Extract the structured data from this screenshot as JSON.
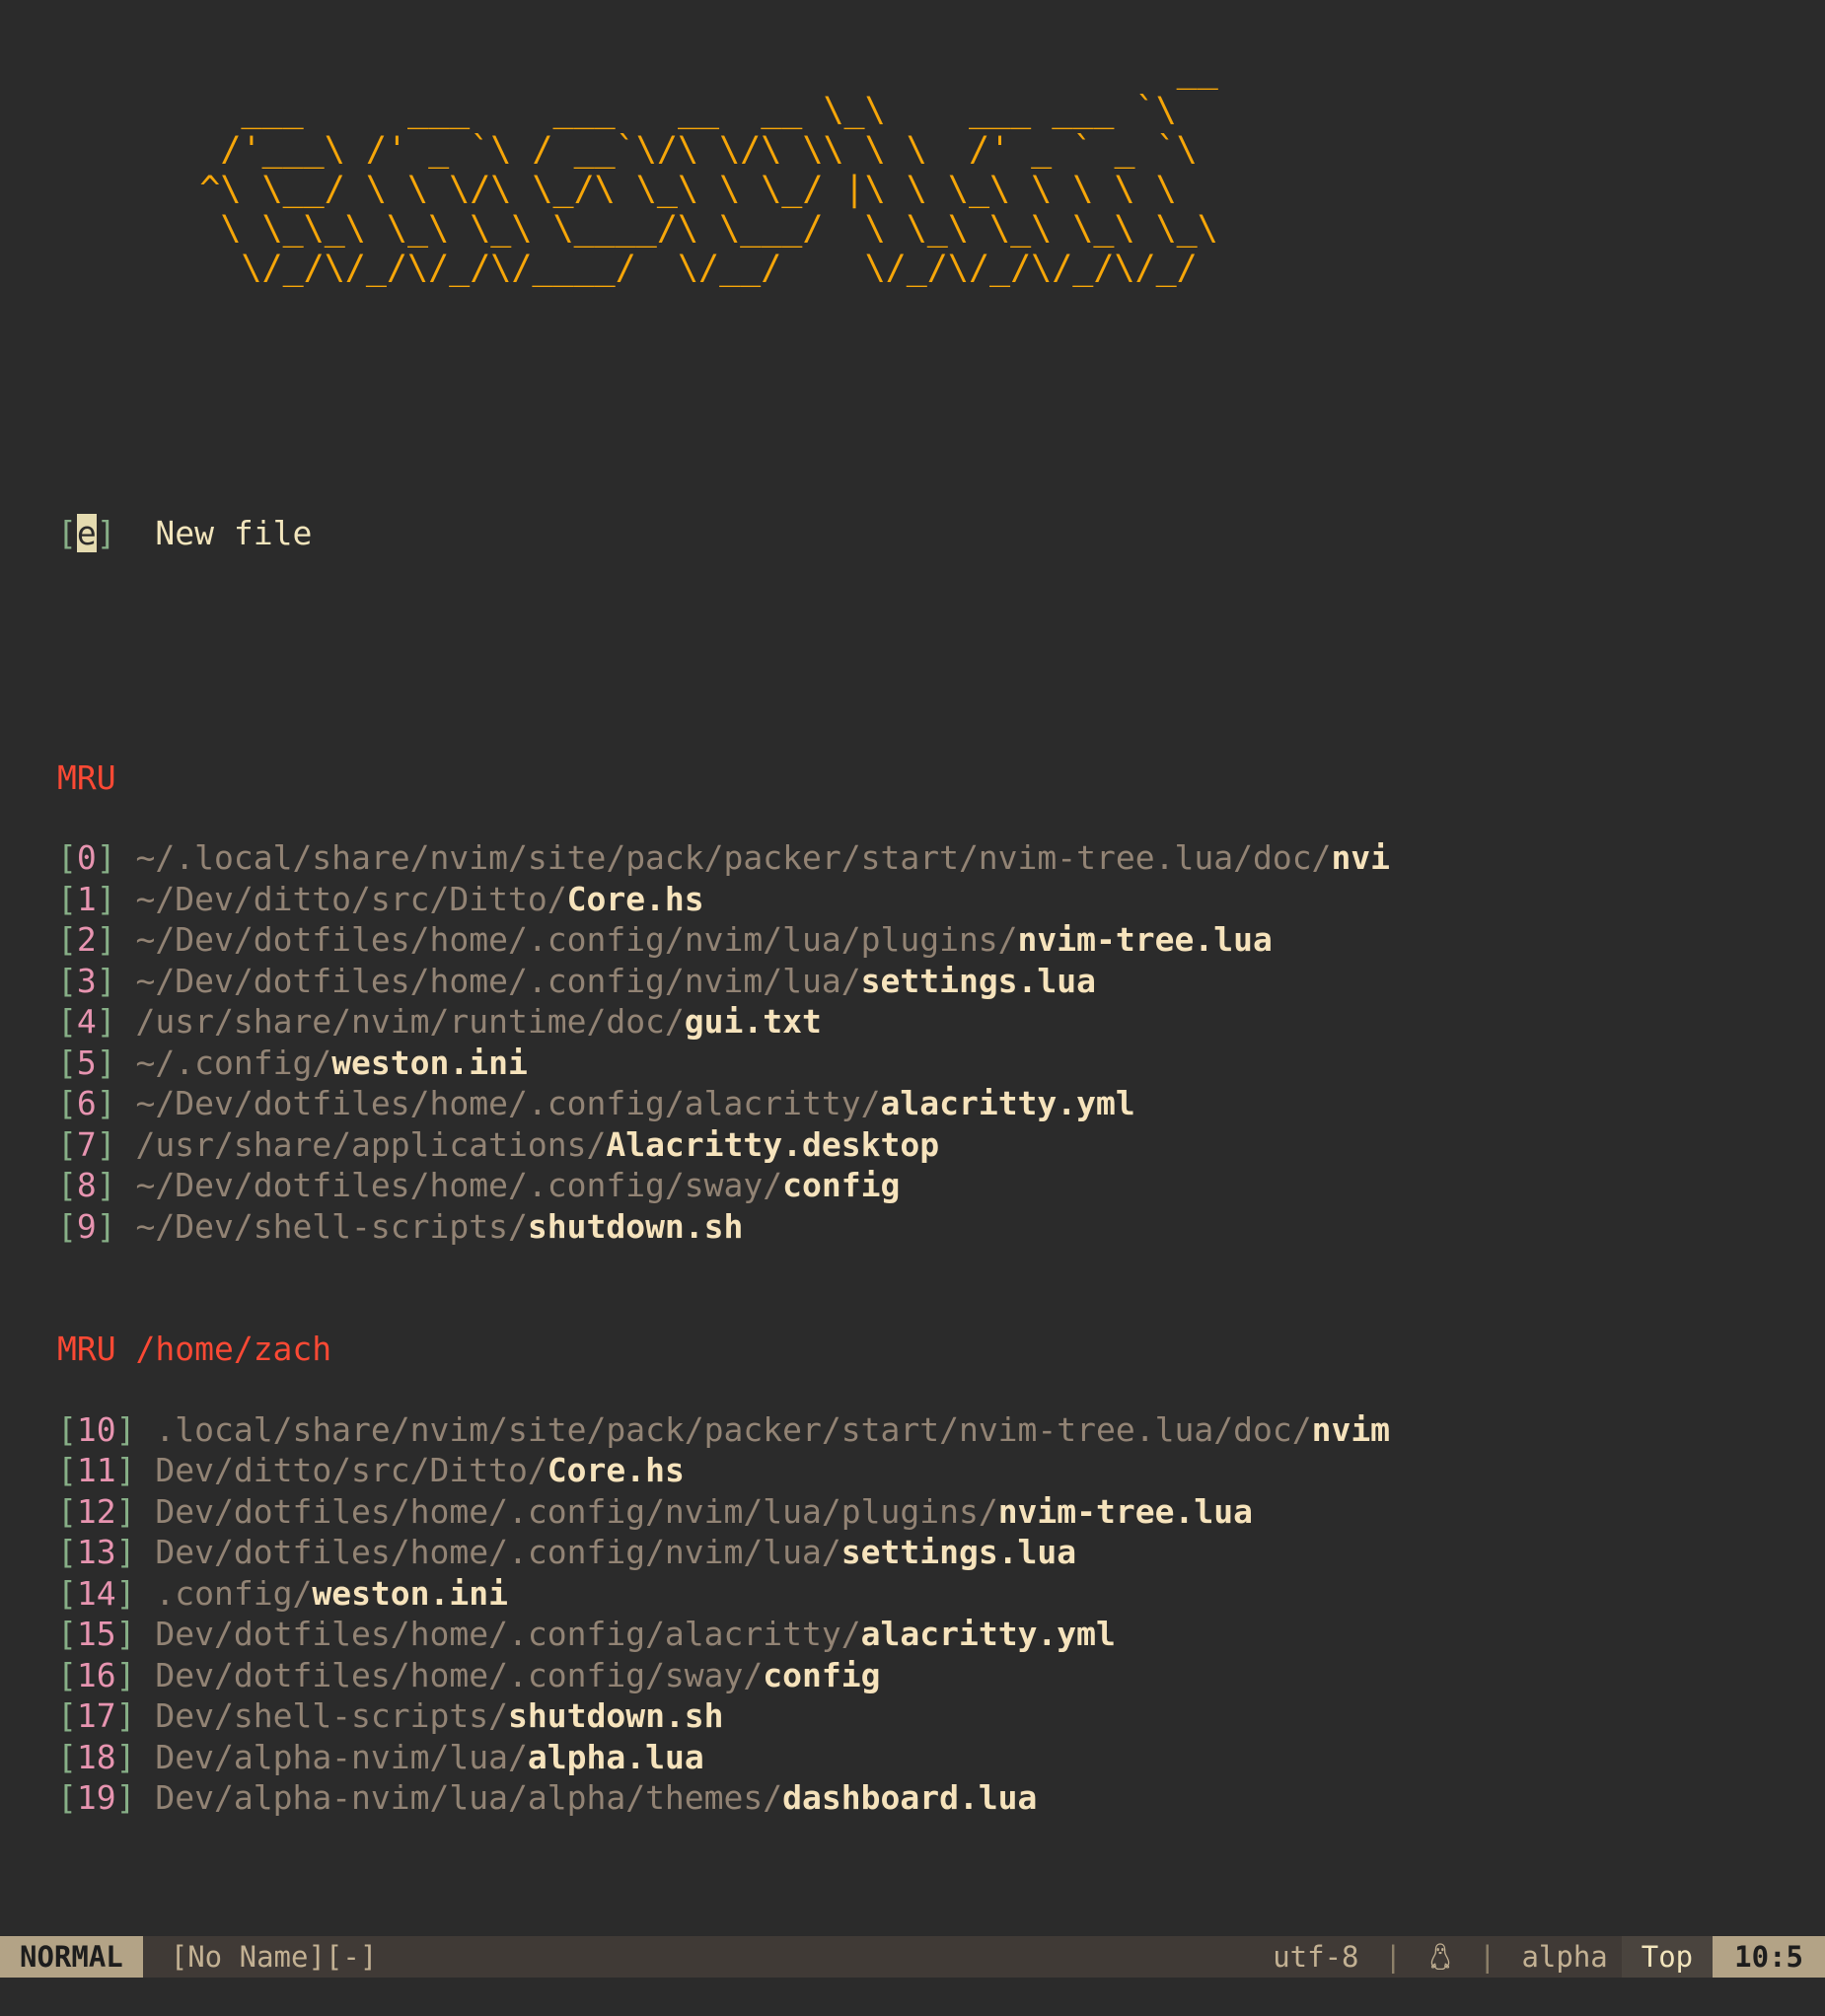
{
  "colors": {
    "background": "#2b2b2b",
    "header_accent": "#f6a609",
    "group_header": "#fb4934",
    "bracket_green": "#87af87",
    "index_pink": "#e794b0",
    "path_dim": "#928374",
    "filename_bright": "#f6e3bc",
    "statusline_bg": "#403a36",
    "statusline_mode_bg": "#b3a386",
    "cursor_bg": "#e4dbb0"
  },
  "header": {
    "name": "neovim-ascii-logo",
    "lines": [
      "                                                   __",
      "      ___     ___    ___   __  __ \\_\\    ___ ___ `\\",
      "     /'___\\ /' _ `\\ / __`\\/\\ \\/\\ \\\\ \\ \\  /' _ ` _ `\\",
      "    ^\\ \\__/ \\ \\ \\/\\ \\_/\\ \\_\\ \\ \\_/ |\\ \\ \\_\\ \\ \\ \\ \\",
      "     \\ \\_\\_\\ \\_\\ \\_\\ \\____/\\ \\___/  \\ \\_\\ \\_\\ \\_\\ \\_\\",
      "      \\/_/\\/_/\\/_/\\/____/  \\/__/    \\/_/\\/_/\\/_/\\/_/"
    ]
  },
  "buttons": [
    {
      "shortcut": "e",
      "open_bracket": "[",
      "close_bracket": "]",
      "label": "New file"
    }
  ],
  "groups": [
    {
      "title": "MRU",
      "cwd": "",
      "entries": [
        {
          "index": "0",
          "dir": "~/.local/share/nvim/site/pack/packer/start/nvim-tree.lua/doc/",
          "name": "nvi"
        },
        {
          "index": "1",
          "dir": "~/Dev/ditto/src/Ditto/",
          "name": "Core.hs"
        },
        {
          "index": "2",
          "dir": "~/Dev/dotfiles/home/.config/nvim/lua/plugins/",
          "name": "nvim-tree.lua"
        },
        {
          "index": "3",
          "dir": "~/Dev/dotfiles/home/.config/nvim/lua/",
          "name": "settings.lua"
        },
        {
          "index": "4",
          "dir": "/usr/share/nvim/runtime/doc/",
          "name": "gui.txt"
        },
        {
          "index": "5",
          "dir": "~/.config/",
          "name": "weston.ini"
        },
        {
          "index": "6",
          "dir": "~/Dev/dotfiles/home/.config/alacritty/",
          "name": "alacritty.yml"
        },
        {
          "index": "7",
          "dir": "/usr/share/applications/",
          "name": "Alacritty.desktop"
        },
        {
          "index": "8",
          "dir": "~/Dev/dotfiles/home/.config/sway/",
          "name": "config"
        },
        {
          "index": "9",
          "dir": "~/Dev/shell-scripts/",
          "name": "shutdown.sh"
        }
      ]
    },
    {
      "title": "MRU",
      "cwd": "/home/zach",
      "entries": [
        {
          "index": "10",
          "dir": ".local/share/nvim/site/pack/packer/start/nvim-tree.lua/doc/",
          "name": "nvim"
        },
        {
          "index": "11",
          "dir": "Dev/ditto/src/Ditto/",
          "name": "Core.hs"
        },
        {
          "index": "12",
          "dir": "Dev/dotfiles/home/.config/nvim/lua/plugins/",
          "name": "nvim-tree.lua"
        },
        {
          "index": "13",
          "dir": "Dev/dotfiles/home/.config/nvim/lua/",
          "name": "settings.lua"
        },
        {
          "index": "14",
          "dir": ".config/",
          "name": "weston.ini"
        },
        {
          "index": "15",
          "dir": "Dev/dotfiles/home/.config/alacritty/",
          "name": "alacritty.yml"
        },
        {
          "index": "16",
          "dir": "Dev/dotfiles/home/.config/sway/",
          "name": "config"
        },
        {
          "index": "17",
          "dir": "Dev/shell-scripts/",
          "name": "shutdown.sh"
        },
        {
          "index": "18",
          "dir": "Dev/alpha-nvim/lua/",
          "name": "alpha.lua"
        },
        {
          "index": "19",
          "dir": "Dev/alpha-nvim/lua/alpha/themes/",
          "name": "dashboard.lua"
        }
      ]
    }
  ],
  "statusline": {
    "mode": "NORMAL",
    "filename": "[No Name][-]",
    "encoding": "utf-8",
    "separator": "|",
    "os_icon": "linux-penguin-icon",
    "os_glyph": "🐧",
    "filetype": "alpha",
    "scroll": "Top",
    "linecol": "10:5"
  }
}
